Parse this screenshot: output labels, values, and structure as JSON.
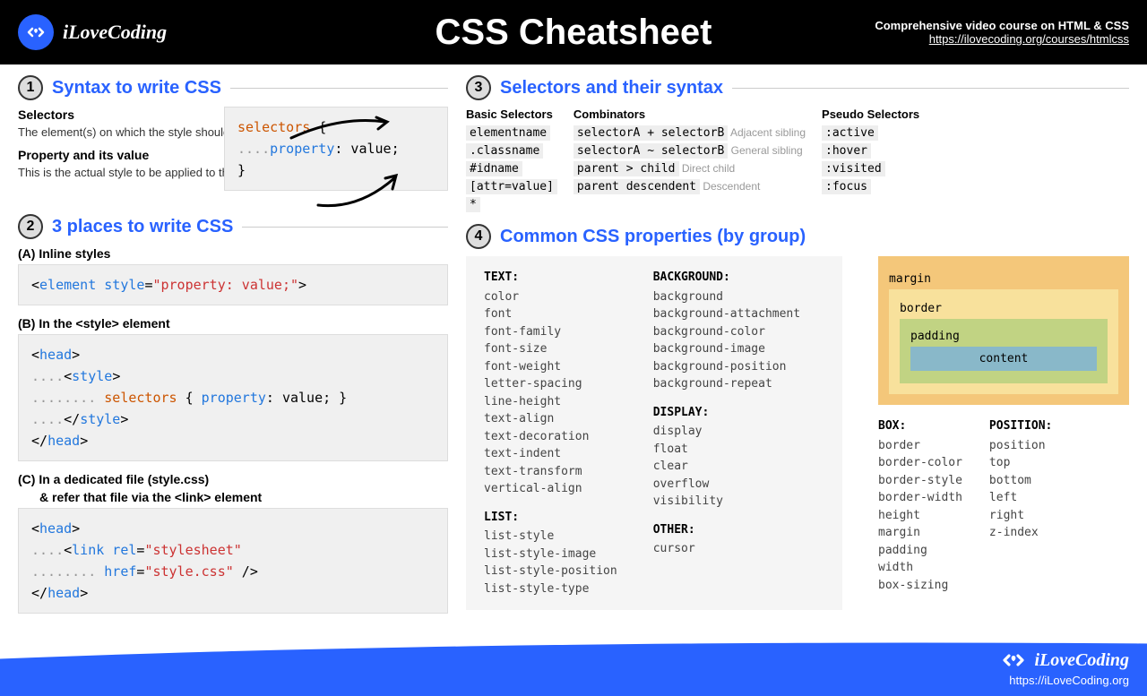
{
  "header": {
    "brand": "iLoveCoding",
    "title": "CSS Cheatsheet",
    "subtitle": "Comprehensive video course on HTML & CSS",
    "url": "https://ilovecoding.org/courses/htmlcss"
  },
  "s1": {
    "title": "Syntax to write CSS",
    "selectors_h": "Selectors",
    "selectors_d": "The element(s) on which the style should be applied",
    "prop_h": "Property and its value",
    "prop_d": "This is the actual style to be applied to the element(s)",
    "code_selectors": "selectors",
    "code_brace_open": " {",
    "code_dots": "....",
    "code_property": "property",
    "code_value": ": value;",
    "code_brace_close": "}"
  },
  "s2": {
    "title": "3 places to write CSS",
    "a_title": "(A) Inline styles",
    "a_lt": "<",
    "a_element": "element",
    "a_sp": " ",
    "a_style": "style",
    "a_eq": "=",
    "a_q1": "\"",
    "a_val": "property: value;",
    "a_q2": "\"",
    "a_gt": ">",
    "b_title": "(B) In the <style> element",
    "b_head_open": "<head>",
    "b_dots4": "....",
    "b_style_open_lt": "<",
    "b_style_tag": "style",
    "b_style_open_gt": ">",
    "b_dots8": "........",
    "b_selectors": " selectors",
    "b_brace": " { ",
    "b_property": "property",
    "b_value": ": value; }",
    "b_style_close_lt": "</",
    "b_style_close_gt": ">",
    "b_head_close": "</head>",
    "c_title": "(C) In a dedicated file (style.css)",
    "c_sub": "& refer that file via the <link> element",
    "c_link_lt": "<",
    "c_link": "link",
    "c_rel": " rel",
    "c_eq": "=",
    "c_relval": "\"stylesheet\"",
    "c_href": " href",
    "c_hrefval": "\"style.css\"",
    "c_close": " />"
  },
  "s3": {
    "title": "Selectors and their syntax",
    "basic_h": "Basic Selectors",
    "basic": [
      "elementname",
      ".classname",
      "#idname",
      "[attr=value]",
      "*"
    ],
    "comb_h": "Combinators",
    "comb": [
      {
        "sel": "selectorA + selectorB",
        "d": "Adjacent sibling"
      },
      {
        "sel": "selectorA ~ selectorB",
        "d": "General sibling"
      },
      {
        "sel": "parent > child",
        "d": "Direct child"
      },
      {
        "sel": "parent descendent",
        "d": "Descendent"
      }
    ],
    "pseudo_h": "Pseudo Selectors",
    "pseudo": [
      ":active",
      ":hover",
      ":visited",
      ":focus"
    ]
  },
  "s4": {
    "title": "Common CSS properties (by group)",
    "text_h": "TEXT:",
    "text": [
      "color",
      "font",
      "font-family",
      "font-size",
      "font-weight",
      "letter-spacing",
      "line-height",
      "text-align",
      "text-decoration",
      "text-indent",
      "text-transform",
      "vertical-align"
    ],
    "list_h": "LIST:",
    "list": [
      "list-style",
      "list-style-image",
      "list-style-position",
      "list-style-type"
    ],
    "bg_h": "BACKGROUND:",
    "bg": [
      "background",
      "background-attachment",
      "background-color",
      "background-image",
      "background-position",
      "background-repeat"
    ],
    "disp_h": "DISPLAY:",
    "disp": [
      "display",
      "float",
      "clear",
      "overflow",
      "visibility"
    ],
    "other_h": "OTHER:",
    "other": [
      "cursor"
    ],
    "box_h": "BOX:",
    "box": [
      "border",
      "border-color",
      "border-style",
      "border-width",
      "height",
      "margin",
      "padding",
      "width",
      "box-sizing"
    ],
    "pos_h": "POSITION:",
    "pos": [
      "position",
      "top",
      "bottom",
      "left",
      "right",
      "z-index"
    ],
    "bm": {
      "margin": "margin",
      "border": "border",
      "padding": "padding",
      "content": "content"
    }
  },
  "footer": {
    "brand": "iLoveCoding",
    "url": "https://iLoveCoding.org"
  }
}
